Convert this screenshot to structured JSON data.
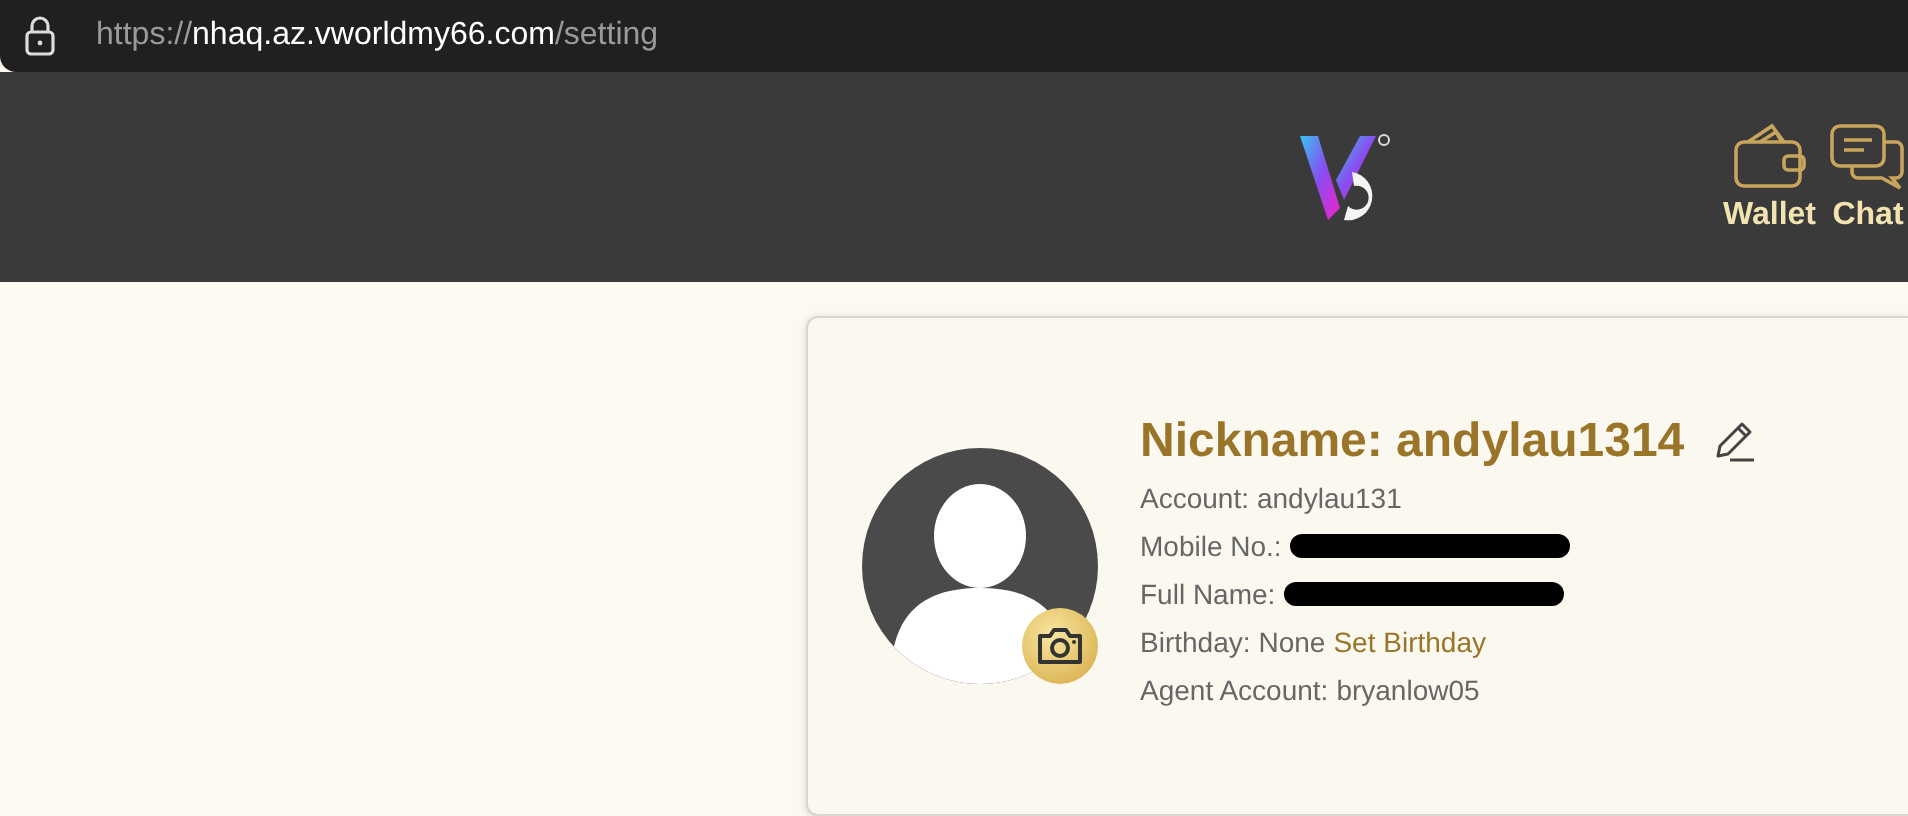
{
  "address_bar": {
    "scheme": "https://",
    "host": "nhaq.az.vworldmy66.com",
    "path": "/setting"
  },
  "header": {
    "nav": [
      {
        "kind": "wallet",
        "label": "Wallet"
      },
      {
        "kind": "chat",
        "label": "Chat"
      }
    ]
  },
  "profile": {
    "nickname": "Nickname: andylau1314",
    "fields": [
      {
        "kind": "text",
        "label": "Account:",
        "value": "andylau131"
      },
      {
        "kind": "redacted",
        "label": "Mobile No.:"
      },
      {
        "kind": "redacted",
        "label": "Full Name:"
      },
      {
        "kind": "text",
        "label": "Birthday:",
        "value": "None",
        "link": "Set Birthday"
      },
      {
        "kind": "text",
        "label": "Agent Account:",
        "value": "bryanlow05"
      }
    ]
  }
}
